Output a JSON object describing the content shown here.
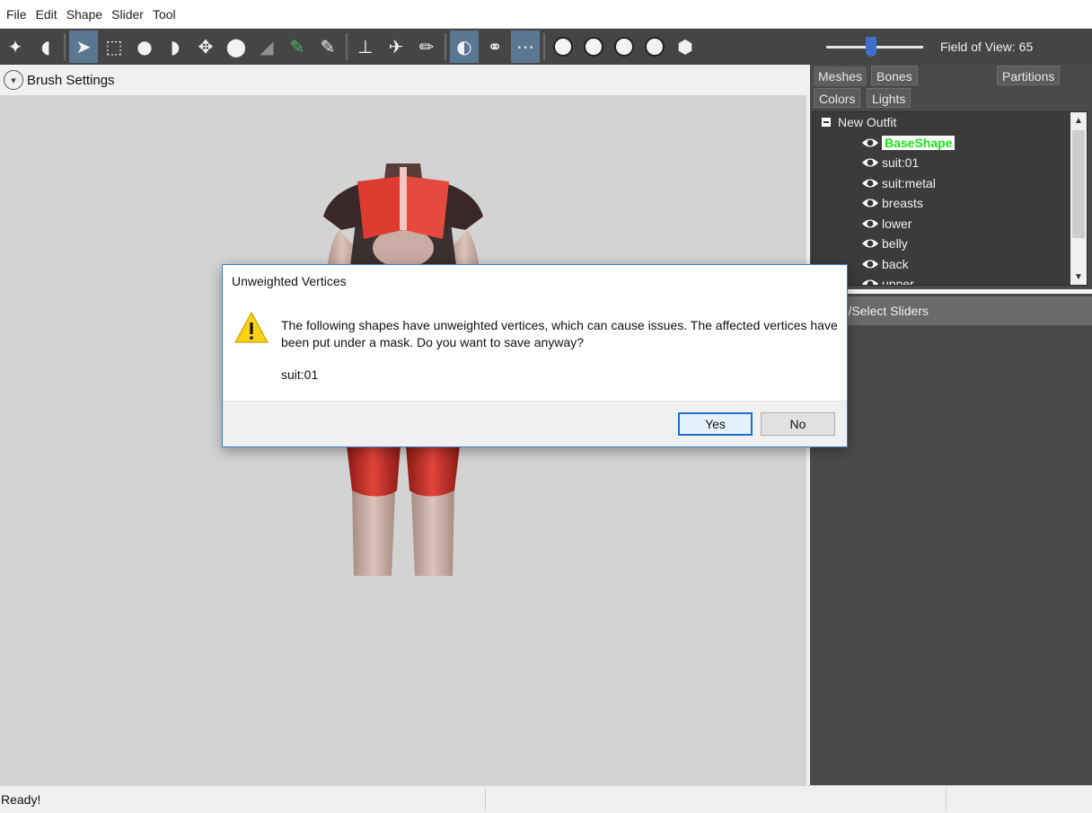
{
  "menu": [
    "File",
    "Edit",
    "Shape",
    "Slider",
    "Tool"
  ],
  "toolbar": {
    "field_of_view_label": "Field of View: 65",
    "fov_slider_value": 65
  },
  "brush_settings": {
    "title": "Brush Settings"
  },
  "right_panel": {
    "tabs": {
      "meshes": "Meshes",
      "bones": "Bones",
      "partitions": "Partitions",
      "colors": "Colors",
      "lights": "Lights"
    },
    "tree": {
      "root": "New Outfit",
      "items": [
        "BaseShape",
        "suit:01",
        "suit:metal",
        "breasts",
        "lower",
        "belly",
        "back",
        "upper"
      ],
      "selected": "BaseShape"
    },
    "sliders_header": "e-/Select Sliders"
  },
  "dialog": {
    "title": "Unweighted Vertices",
    "message": "The following shapes have unweighted vertices, which can cause issues. The affected vertices have been put under a mask. Do you want to save anyway?",
    "shape": "suit:01",
    "yes_label": "Yes",
    "no_label": "No"
  },
  "status": {
    "text": "Ready!"
  },
  "colors": {
    "toolbar_bg": "#454545",
    "active_tool": "#5a7792",
    "selected_mesh_text": "#19e619",
    "dialog_border": "#3b7ed1"
  }
}
